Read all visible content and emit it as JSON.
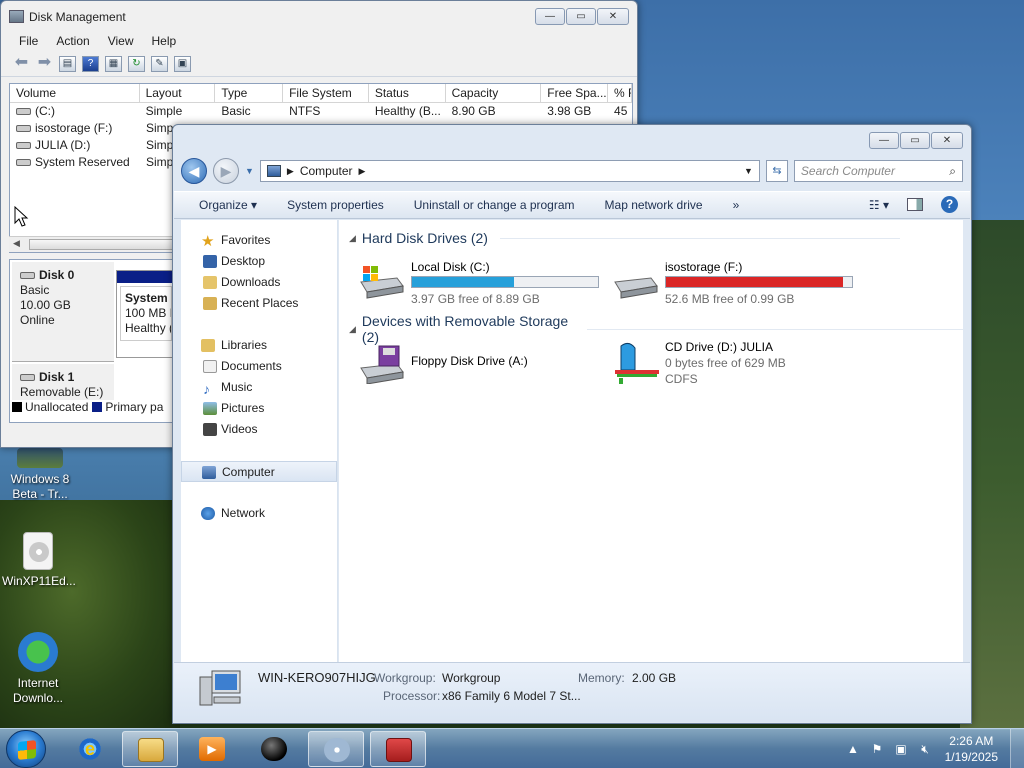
{
  "desktop": {
    "icons": [
      {
        "label": "Windows 8 Beta - Tr...",
        "icon": "video-thumbnail-icon"
      },
      {
        "label": "WinXP11Ed...",
        "icon": "disc-image-icon"
      },
      {
        "label": "Internet Downlo...",
        "icon": "internet-download-manager-icon"
      }
    ]
  },
  "disk_management": {
    "title": "Disk Management",
    "menu": [
      "File",
      "Action",
      "View",
      "Help"
    ],
    "toolbar_icons": [
      "back-icon",
      "forward-icon",
      "properties-icon",
      "help-icon",
      "view-icon",
      "refresh-icon",
      "settings-icon",
      "disk-icon"
    ],
    "columns": [
      "Volume",
      "Layout",
      "Type",
      "File System",
      "Status",
      "Capacity",
      "Free Spa...",
      "% F"
    ],
    "rows": [
      {
        "volume": "(C:)",
        "layout": "Simple",
        "type": "Basic",
        "fs": "NTFS",
        "status": "Healthy (B...",
        "capacity": "8.90 GB",
        "free": "3.98 GB",
        "pct": "45"
      },
      {
        "volume": "isostorage (F:)",
        "layout": "Simp",
        "type": "",
        "fs": "",
        "status": "",
        "capacity": "",
        "free": "",
        "pct": ""
      },
      {
        "volume": "JULIA (D:)",
        "layout": "Simp",
        "type": "",
        "fs": "",
        "status": "",
        "capacity": "",
        "free": "",
        "pct": ""
      },
      {
        "volume": "System Reserved",
        "layout": "Simp",
        "type": "",
        "fs": "",
        "status": "",
        "capacity": "",
        "free": "",
        "pct": ""
      }
    ],
    "disk0": {
      "name": "Disk 0",
      "kind": "Basic",
      "size": "10.00 GB",
      "state": "Online",
      "partition": {
        "name": "System R",
        "detail": "100 MB N",
        "status": "Healthy ("
      }
    },
    "disk1": {
      "name": "Disk 1",
      "kind": "Removable (E:)"
    },
    "legend": [
      {
        "label": "Unallocated",
        "color": "#000000"
      },
      {
        "label": "Primary pa",
        "color": "#0a1f87"
      }
    ]
  },
  "explorer": {
    "breadcrumb": "Computer",
    "search_placeholder": "Search Computer",
    "commands": [
      "Organize ▾",
      "System properties",
      "Uninstall or change a program",
      "Map network drive",
      "»"
    ],
    "nav": {
      "favorites": "Favorites",
      "favorites_items": [
        "Desktop",
        "Downloads",
        "Recent Places"
      ],
      "libraries": "Libraries",
      "libraries_items": [
        "Documents",
        "Music",
        "Pictures",
        "Videos"
      ],
      "computer": "Computer",
      "network": "Network"
    },
    "hdd_group": "Hard Disk Drives (2)",
    "drives": [
      {
        "name": "Local Disk (C:)",
        "free_text": "3.97 GB free of 8.89 GB",
        "used_fraction": 0.55,
        "bar_color": "#26a0da"
      },
      {
        "name": "isostorage (F:)",
        "free_text": "52.6 MB free of 0.99 GB",
        "used_fraction": 0.95,
        "bar_color": "#da2626"
      }
    ],
    "removable_group": "Devices with Removable Storage (2)",
    "removable": [
      {
        "name": "Floppy Disk Drive (A:)"
      },
      {
        "name": "CD Drive (D:) JULIA",
        "free_text": "0 bytes free of 629 MB",
        "fs": "CDFS"
      }
    ],
    "details": {
      "computer_name": "WIN-KERO907HIJG",
      "workgroup_label": "Workgroup:",
      "workgroup": "Workgroup",
      "memory_label": "Memory:",
      "memory": "2.00 GB",
      "processor_label": "Processor:",
      "processor": "x86 Family 6 Model 7 St..."
    }
  },
  "taskbar": {
    "apps": [
      "internet-explorer-icon",
      "explorer-folder-icon",
      "media-player-icon",
      "game-icon",
      "cd-burner-icon",
      "toolbox-icon"
    ],
    "time": "2:26 AM",
    "date": "1/19/2025"
  }
}
